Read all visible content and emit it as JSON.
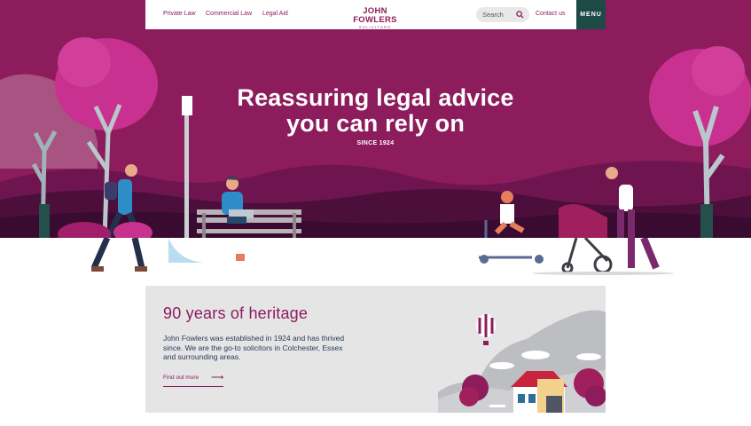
{
  "nav": {
    "links": [
      "Private Law",
      "Commercial Law",
      "Legal Aid"
    ],
    "logo_main": "JOHN FOWLERS",
    "logo_sub": "SOLICITORS",
    "search_placeholder": "Search",
    "contact": "Contact us",
    "menu": "MENU"
  },
  "hero": {
    "title_line1": "Reassuring legal advice",
    "title_line2": "you can rely on",
    "subtitle": "SINCE 1924"
  },
  "card": {
    "title": "90 years of heritage",
    "body": "John Fowlers was established in 1924 and has thrived since. We are the go-to solicitors in Colchester, Essex and surrounding areas.",
    "link": "Find out more"
  },
  "icons": {
    "search": "search-icon",
    "arrow": "arrow-right-icon"
  },
  "colors": {
    "brand": "#8c1c5c",
    "menu_bg": "#1d4a46",
    "card_bg": "#e5e5e6"
  }
}
